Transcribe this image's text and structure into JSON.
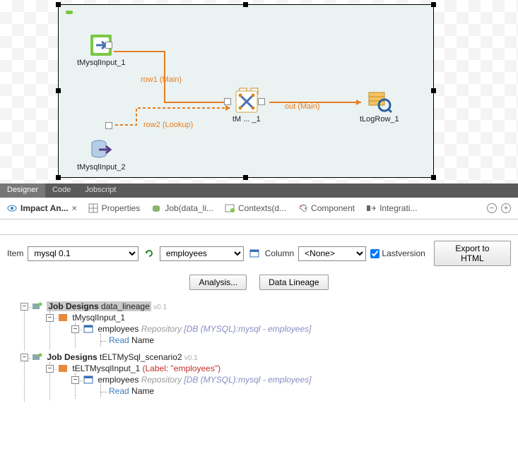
{
  "canvas": {
    "nodes": {
      "mysql1": "tMysqlInput_1",
      "mysql2": "tMysqlInput_2",
      "tmap": "tM ... _1",
      "log": "tLogRow_1"
    },
    "flows": {
      "row1": "row1 (Main)",
      "row2": "row2 (Lookup)",
      "out": "out (Main)"
    }
  },
  "tabs": {
    "designer": "Designer",
    "code": "Code",
    "jobscript": "Jobscript"
  },
  "views": {
    "impact": "Impact An...",
    "properties": "Properties",
    "job": "Job(data_li...",
    "contexts": "Contexts(d...",
    "component": "Component",
    "integration": "Integrati..."
  },
  "toolbar": {
    "item_label": "Item",
    "item_value": "mysql 0.1",
    "table_value": "employees",
    "column_label": "Column",
    "column_value": "<None>",
    "lastversion": "Lastversion",
    "export": "Export to HTML",
    "analysis": "Analysis...",
    "lineage": "Data Lineage"
  },
  "tree": {
    "job1_label": "Job Designs",
    "job1_name": "data_lineage",
    "job1_ver": "v0.1",
    "comp1": "tMysqlInput_1",
    "comp1_table": "employees",
    "comp1_repo": "Repository",
    "comp1_bracket": "[DB (MYSQL):mysql - employees]",
    "comp1_op": "Read",
    "comp1_col": "Name",
    "job2_label": "Job Designs",
    "job2_name": "tELTMySql_scenario2",
    "job2_ver": "v0.1",
    "comp2": "tELTMysqlInput_1",
    "comp2_detail": "(Label: \"employees\")",
    "comp2_table": "employees",
    "comp2_repo": "Repository",
    "comp2_bracket": "[DB (MYSQL):mysql - employees]",
    "comp2_op": "Read",
    "comp2_col": "Name"
  }
}
